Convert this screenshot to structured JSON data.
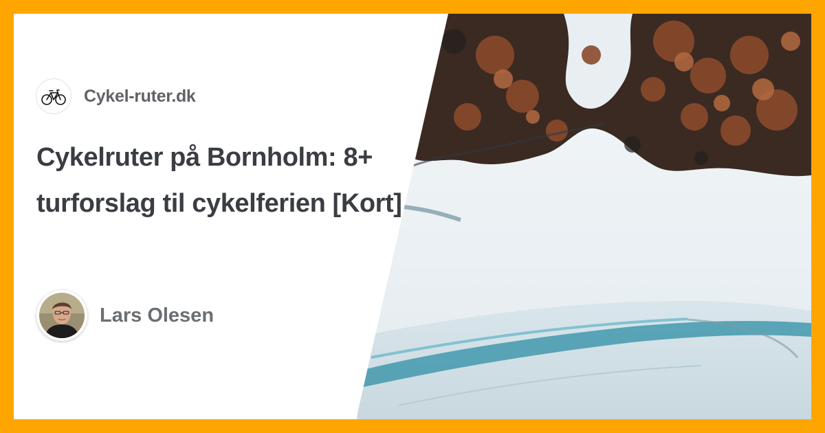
{
  "brand": {
    "name": "Cykel-ruter.dk",
    "logo_icon": "bicycle-icon"
  },
  "article": {
    "title": "Cykelruter på Bornholm: 8+ turforslag til cykelferien [Kort]"
  },
  "author": {
    "name": "Lars Olesen",
    "avatar_icon": "author-portrait"
  },
  "hero_image": {
    "subject": "aerial-forest-frozen-shore-photo"
  },
  "colors": {
    "frame": "#FFA500",
    "title": "#3a3d42",
    "muted": "#5f6368"
  }
}
